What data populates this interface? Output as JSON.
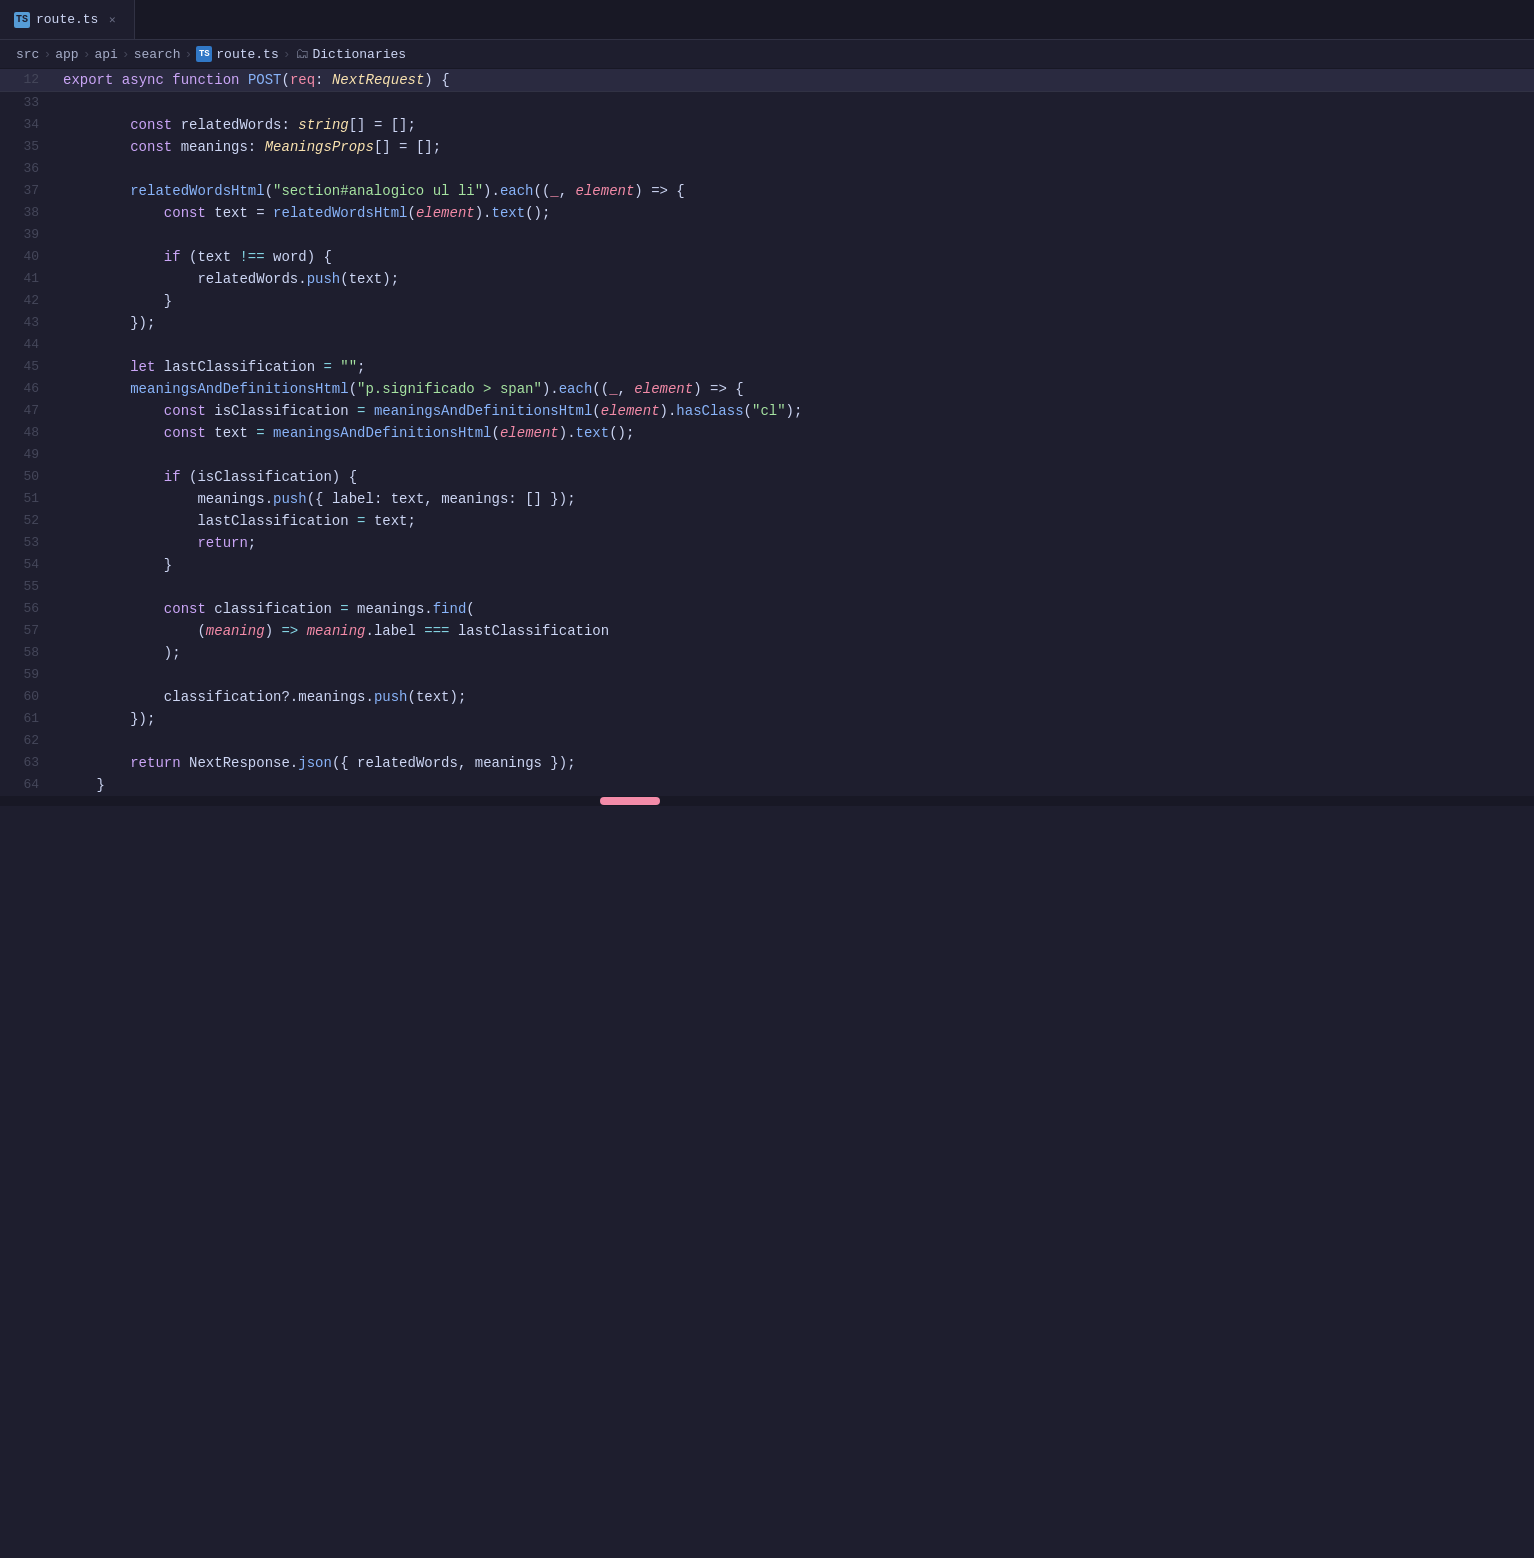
{
  "tab": {
    "icon_label": "TS",
    "filename": "route.ts",
    "close_label": "✕"
  },
  "breadcrumb": {
    "parts": [
      "src",
      "app",
      "api",
      "search",
      "route.ts",
      "Dictionaries"
    ],
    "separators": [
      ">",
      ">",
      ">",
      ">",
      ">"
    ]
  },
  "header": {
    "line_number": "12",
    "content": "export async function POST(req: NextRequest) {"
  },
  "lines": [
    {
      "num": "33",
      "tokens": []
    },
    {
      "num": "34",
      "raw": "        const relatedWords: string[] = [];"
    },
    {
      "num": "35",
      "raw": "        const meanings: MeaningsProps[] = [];"
    },
    {
      "num": "36",
      "tokens": []
    },
    {
      "num": "37",
      "raw": "        relatedWordsHtml(\"section#analogico ul li\").each((_, element) => {"
    },
    {
      "num": "38",
      "raw": "            const text = relatedWordsHtml(element).text();"
    },
    {
      "num": "39",
      "tokens": []
    },
    {
      "num": "40",
      "raw": "            if (text !== word) {"
    },
    {
      "num": "41",
      "raw": "                relatedWords.push(text);"
    },
    {
      "num": "42",
      "raw": "            }"
    },
    {
      "num": "43",
      "raw": "        });"
    },
    {
      "num": "44",
      "tokens": []
    },
    {
      "num": "45",
      "raw": "        let lastClassification = \"\";"
    },
    {
      "num": "46",
      "raw": "        meaningsAndDefinitionsHtml(\"p.significado > span\").each((_, element) => {"
    },
    {
      "num": "47",
      "raw": "            const isClassification = meaningsAndDefinitionsHtml(element).hasClass(\"cl\");"
    },
    {
      "num": "48",
      "raw": "            const text = meaningsAndDefinitionsHtml(element).text();"
    },
    {
      "num": "49",
      "tokens": []
    },
    {
      "num": "50",
      "raw": "            if (isClassification) {"
    },
    {
      "num": "51",
      "raw": "                meanings.push({ label: text, meanings: [] });"
    },
    {
      "num": "52",
      "raw": "                lastClassification = text;"
    },
    {
      "num": "53",
      "raw": "                return;"
    },
    {
      "num": "54",
      "raw": "            }"
    },
    {
      "num": "55",
      "tokens": []
    },
    {
      "num": "56",
      "raw": "            const classification = meanings.find("
    },
    {
      "num": "57",
      "raw": "                (meaning) => meaning.label === lastClassification"
    },
    {
      "num": "58",
      "raw": "            );"
    },
    {
      "num": "59",
      "tokens": []
    },
    {
      "num": "60",
      "raw": "            classification?.meanings.push(text);"
    },
    {
      "num": "61",
      "raw": "        });"
    },
    {
      "num": "62",
      "tokens": []
    },
    {
      "num": "63",
      "raw": "        return NextResponse.json({ relatedWords, meanings });"
    },
    {
      "num": "64",
      "raw": "    }"
    }
  ]
}
